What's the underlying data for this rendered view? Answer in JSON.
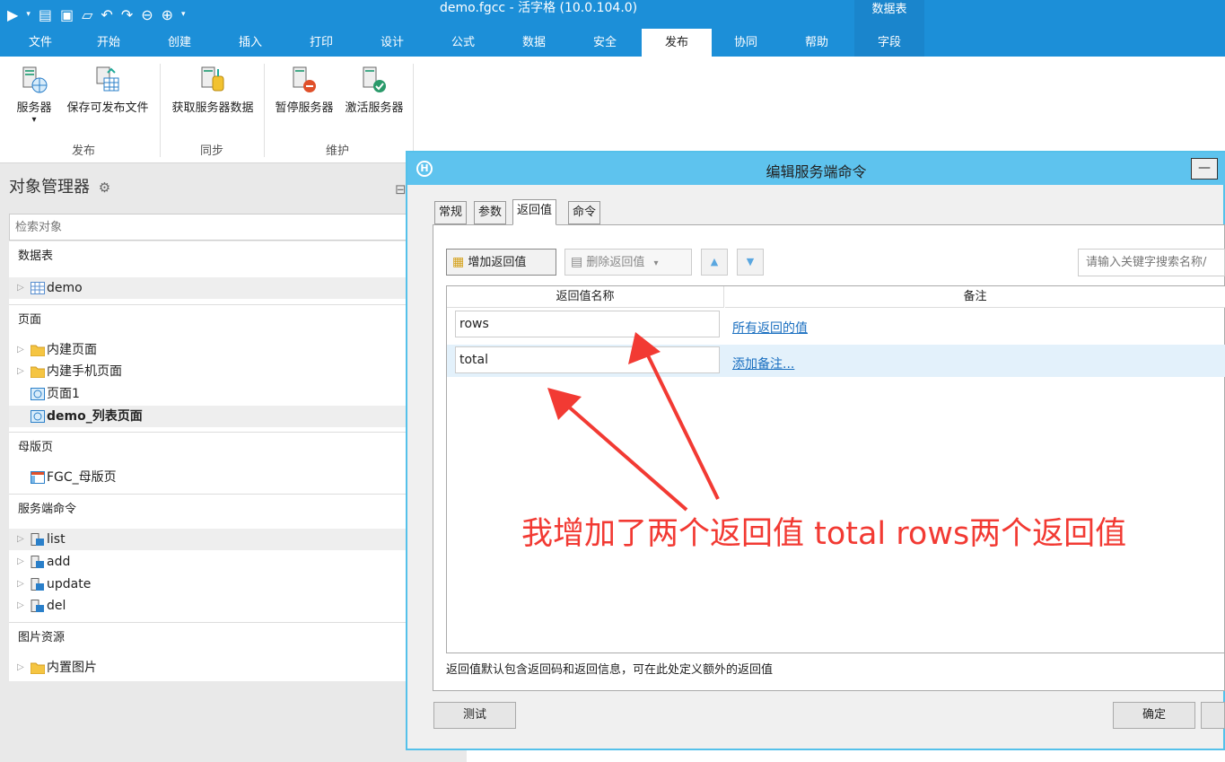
{
  "window": {
    "title": "demo.fgcc - 活字格 (10.0.104.0)",
    "context_tab": "数据表"
  },
  "ribbon_tabs": [
    "文件",
    "开始",
    "创建",
    "插入",
    "打印",
    "设计",
    "公式",
    "数据",
    "安全",
    "发布",
    "协同",
    "帮助",
    "字段"
  ],
  "active_tab_index": 9,
  "ribbon": {
    "groups": [
      {
        "label": "发布",
        "buttons": [
          "服务器",
          "保存可发布文件"
        ]
      },
      {
        "label": "同步",
        "buttons": [
          "获取服务器数据"
        ]
      },
      {
        "label": "维护",
        "buttons": [
          "暂停服务器",
          "激活服务器"
        ]
      }
    ],
    "dropdown_caret": "▾"
  },
  "object_manager": {
    "title": "对象管理器",
    "search_placeholder": "检索对象",
    "sections": {
      "tables": {
        "label": "数据表",
        "items": [
          "demo"
        ]
      },
      "pages": {
        "label": "页面",
        "items": [
          "内建页面",
          "内建手机页面",
          "页面1",
          "demo_列表页面"
        ]
      },
      "master": {
        "label": "母版页",
        "items": [
          "FGC_母版页"
        ]
      },
      "server_cmds": {
        "label": "服务端命令",
        "items": [
          "list",
          "add",
          "update",
          "del"
        ]
      },
      "images": {
        "label": "图片资源",
        "items": [
          "内置图片"
        ]
      }
    }
  },
  "dialog": {
    "title": "编辑服务端命令",
    "logo": "H",
    "minimize": "—",
    "tabs": [
      "常规",
      "参数",
      "返回值",
      "命令"
    ],
    "active_tab_index": 2,
    "toolbar": {
      "add": "增加返回值",
      "delete": "删除返回值",
      "delete_caret": "▾",
      "up": "▲",
      "down": "▼"
    },
    "search_placeholder": "请输入关键字搜索名称/",
    "columns": [
      "返回值名称",
      "备注"
    ],
    "rows": [
      {
        "name": "rows",
        "note": "所有返回的值"
      },
      {
        "name": "total",
        "note": "添加备注..."
      }
    ],
    "hint": "返回值默认包含返回码和返回信息，可在此处定义额外的返回值",
    "buttons": {
      "test": "测试",
      "ok": "确定"
    }
  },
  "annotation": {
    "text": "我增加了两个返回值 total rows两个返回值",
    "color": "#f23a33"
  }
}
